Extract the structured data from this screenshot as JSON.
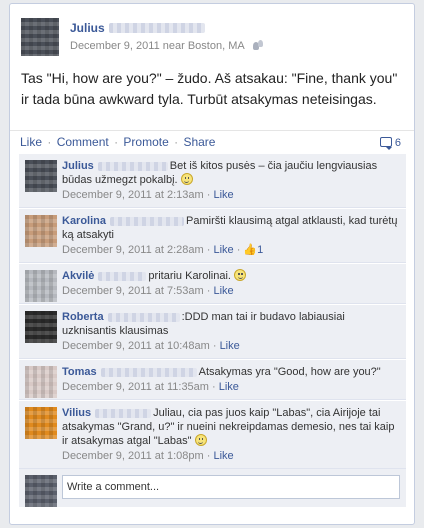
{
  "post": {
    "author": "Julius",
    "date": "December 9, 2011",
    "near": "near",
    "location": "Boston, MA",
    "body": "Tas \"Hi, how are you?\" – žudo. Aš atsakau: \"Fine, thank you\" ir tada būna awkward tyla. Turbūt atsakymas neteisingas."
  },
  "actions": {
    "like": "Like",
    "comment": "Comment",
    "promote": "Promote",
    "share": "Share",
    "comment_count": "6"
  },
  "comments": [
    {
      "author": "Julius",
      "text": "Bet iš kitos pusės – čia jaučiu lengviausias būdas užmegzt pokalbį.",
      "timestamp": "December 9, 2011 at 2:13am",
      "like_label": "Like",
      "avatar_color": "#4a4f58"
    },
    {
      "author": "Karolina",
      "text": "Pamiršti klausimą atgal atklausti, kad turėtų ką atsakyti",
      "timestamp": "December 9, 2011 at 2:28am",
      "like_label": "Like",
      "like_count": "1",
      "avatar_color": "#c79c7a"
    },
    {
      "author": "Akvilė",
      "text": "pritariu Karolinai.",
      "timestamp": "December 9, 2011 at 7:53am",
      "like_label": "Like",
      "avatar_color": "#b5b8be"
    },
    {
      "author": "Roberta",
      "text": ":DDD man tai ir budavo labiausiai uzknisantis klausimas",
      "timestamp": "December 9, 2011 at 10:48am",
      "like_label": "Like",
      "avatar_color": "#2b2b2b"
    },
    {
      "author": "Tomas",
      "text": "Atsakymas yra \"Good, how are you?\"",
      "timestamp": "December 9, 2011 at 11:35am",
      "like_label": "Like",
      "avatar_color": "#d8c9c6"
    },
    {
      "author": "Vilius",
      "text": "Juliau, cia pas juos kaip \"Labas\", cia Airijoje tai atsakymas \"Grand, u?\" ir nueini nekreipdamas demesio, nes tai kaip ir atsakymas atgal \"Labas\"",
      "timestamp": "December 9, 2011 at 1:08pm",
      "like_label": "Like",
      "avatar_color": "#e08a1e"
    }
  ],
  "composer": {
    "placeholder": "Write a comment...",
    "avatar_color": "#5a5f6b"
  },
  "colors": {
    "link": "#3b5998",
    "comments_bg": "#edeff4"
  }
}
